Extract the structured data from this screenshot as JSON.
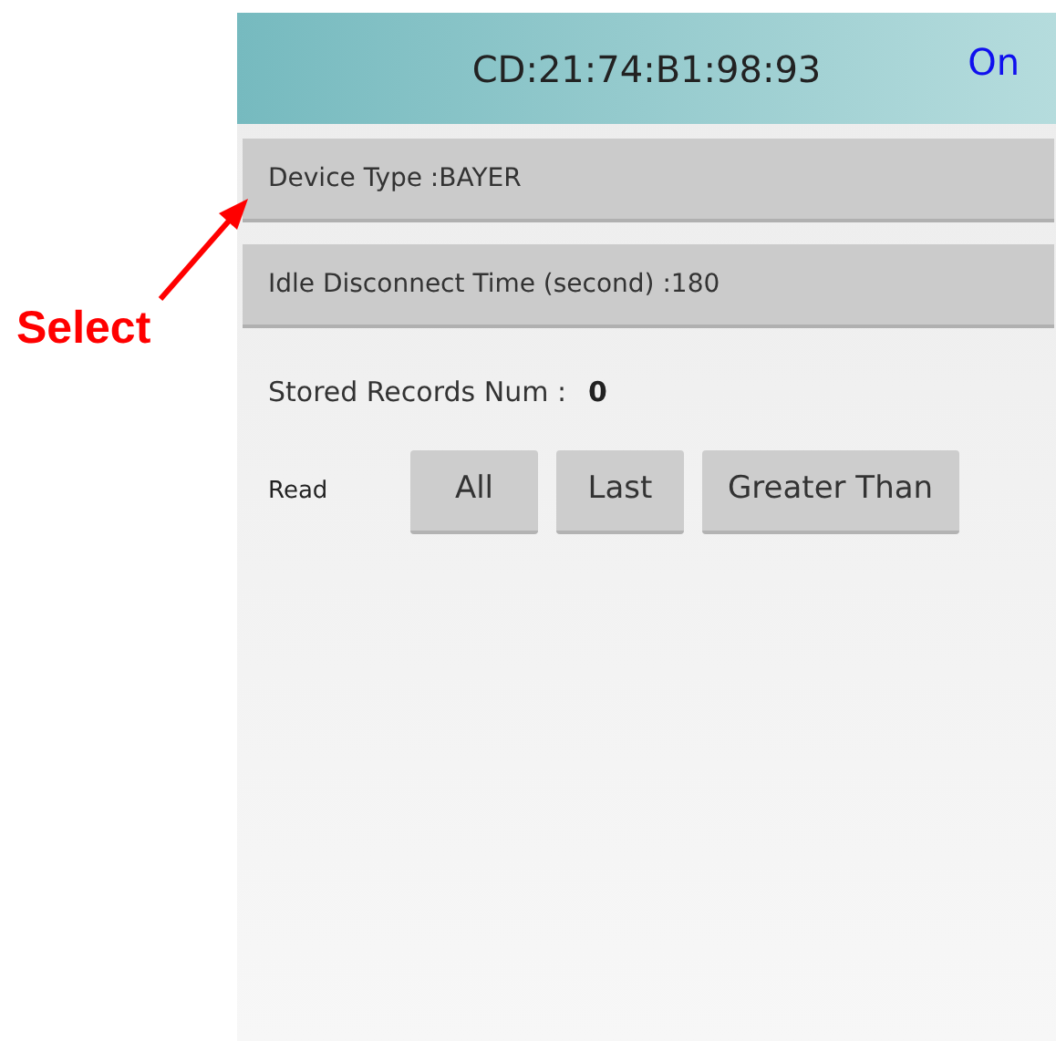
{
  "annotation": {
    "label": "Select"
  },
  "header": {
    "title": "CD:21:74:B1:98:93",
    "status": "On"
  },
  "settings": [
    {
      "label": "Device Type :BAYER"
    },
    {
      "label": "Idle Disconnect Time (second) :180"
    }
  ],
  "stored_records": {
    "label": "Stored Records Num :",
    "value": "0"
  },
  "read": {
    "label": "Read",
    "buttons": [
      "All",
      "Last",
      "Greater Than"
    ]
  }
}
